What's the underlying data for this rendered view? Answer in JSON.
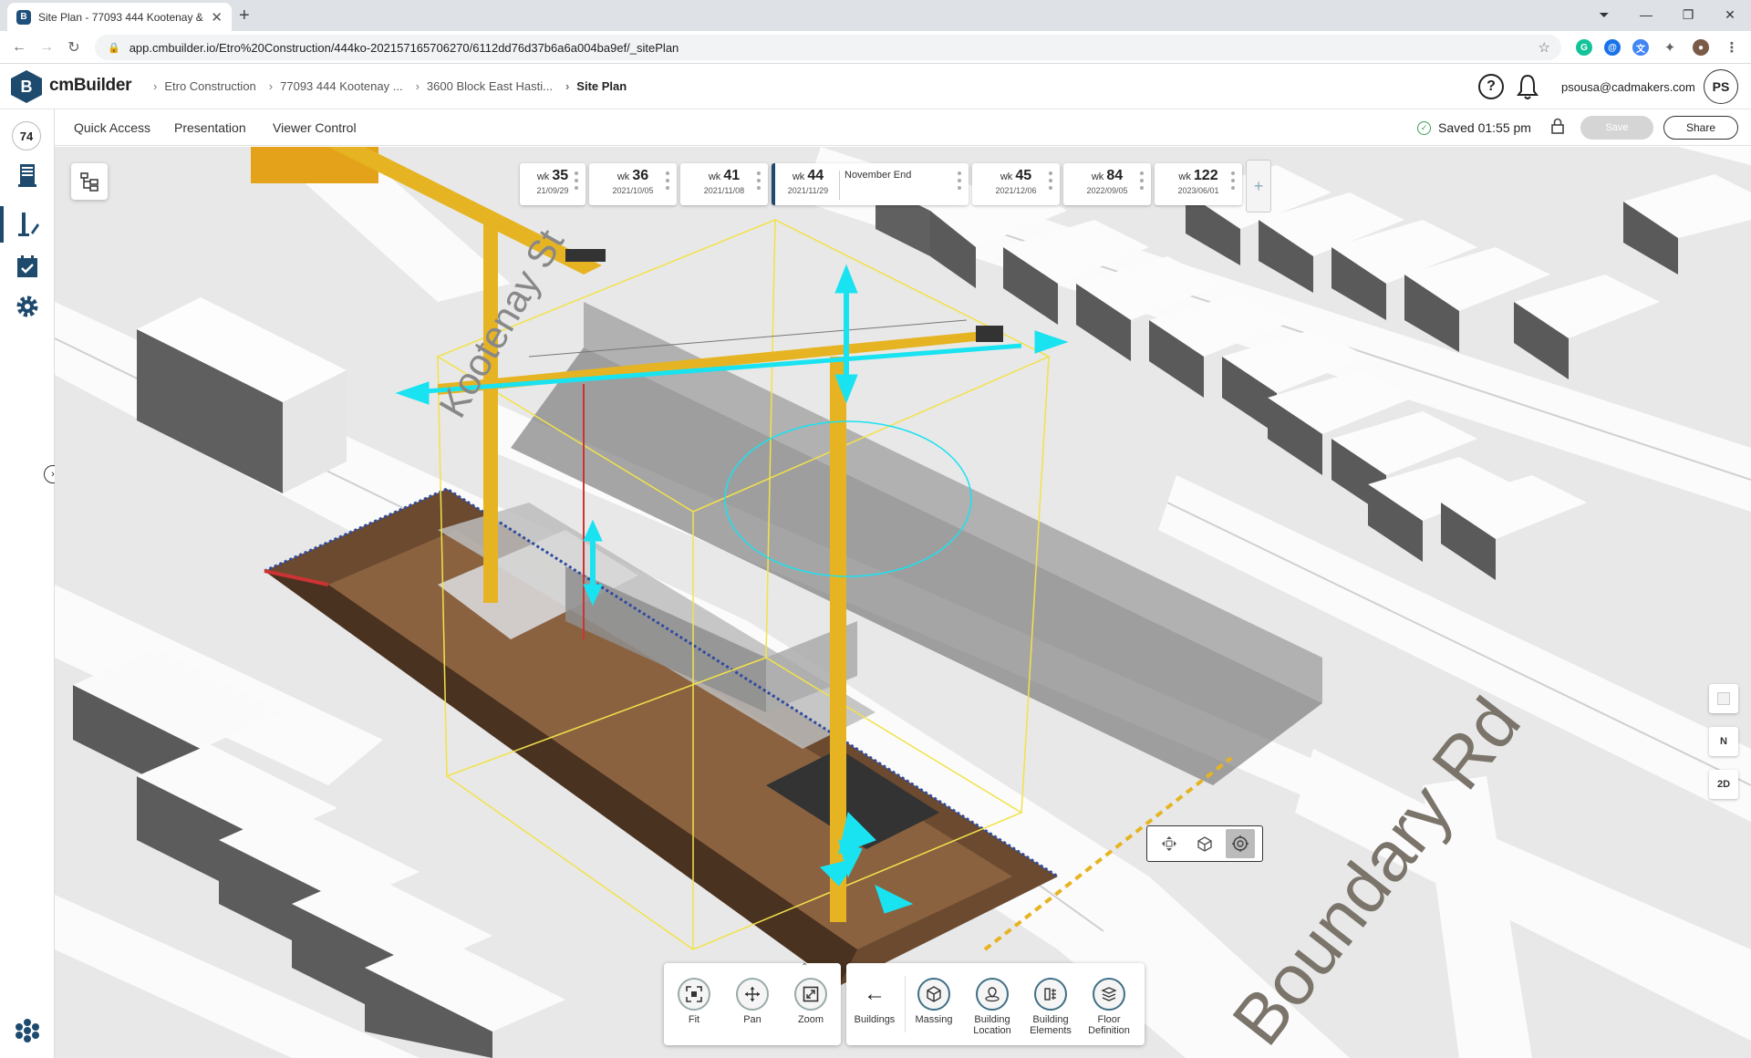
{
  "browser": {
    "tab_title": "Site Plan - 77093 444 Kootenay &",
    "tab_favicon": "B",
    "url": "app.cmbuilder.io/Etro%20Construction/444ko-202157165706270/6112dd76d37b6a6a004ba9ef/_sitePlan",
    "ext_grammarly": "G"
  },
  "app": {
    "logo_letter": "B",
    "logo_text": "cmBuilder",
    "breadcrumbs": [
      "Etro Construction",
      "77093 444 Kootenay ...",
      "3600 Block East Hasti...",
      "Site Plan"
    ],
    "help_label": "?",
    "user_email": "psousa@cadmakers.com",
    "user_initials": "PS",
    "rail_badge": "74"
  },
  "toolbar": {
    "menu": [
      "Quick Access",
      "Presentation",
      "Viewer Control"
    ],
    "saved_text": "Saved 01:55 pm",
    "save_label": "Save",
    "share_label": "Share"
  },
  "timeline": {
    "weeks": [
      {
        "wk": "wk",
        "num": "35",
        "date": "21/09/29"
      },
      {
        "wk": "wk",
        "num": "36",
        "date": "2021/10/05"
      },
      {
        "wk": "wk",
        "num": "41",
        "date": "2021/11/08"
      },
      {
        "wk": "wk",
        "num": "44",
        "date": "2021/11/29",
        "label": "November End"
      },
      {
        "wk": "wk",
        "num": "45",
        "date": "2021/12/06"
      },
      {
        "wk": "wk",
        "num": "84",
        "date": "2022/09/05"
      },
      {
        "wk": "wk",
        "num": "122",
        "date": "2023/06/01"
      }
    ],
    "add_label": "+"
  },
  "scene": {
    "street_labels": [
      "Kootenay St",
      "Boundary Rd"
    ]
  },
  "right_controls": {
    "compass_label": "N",
    "view_2d_label": "2D"
  },
  "bottom_left_tools": [
    "Fit",
    "Pan",
    "Zoom"
  ],
  "bottom_right_tools": {
    "back_label": "Buildings",
    "items": [
      "Massing",
      "Building Location",
      "Building Elements",
      "Floor Definition"
    ]
  },
  "colors": {
    "brand": "#1e4a6e",
    "gizmo": "#19e3f0",
    "crane": "#e6b422",
    "excavation": "#6b4a30"
  }
}
